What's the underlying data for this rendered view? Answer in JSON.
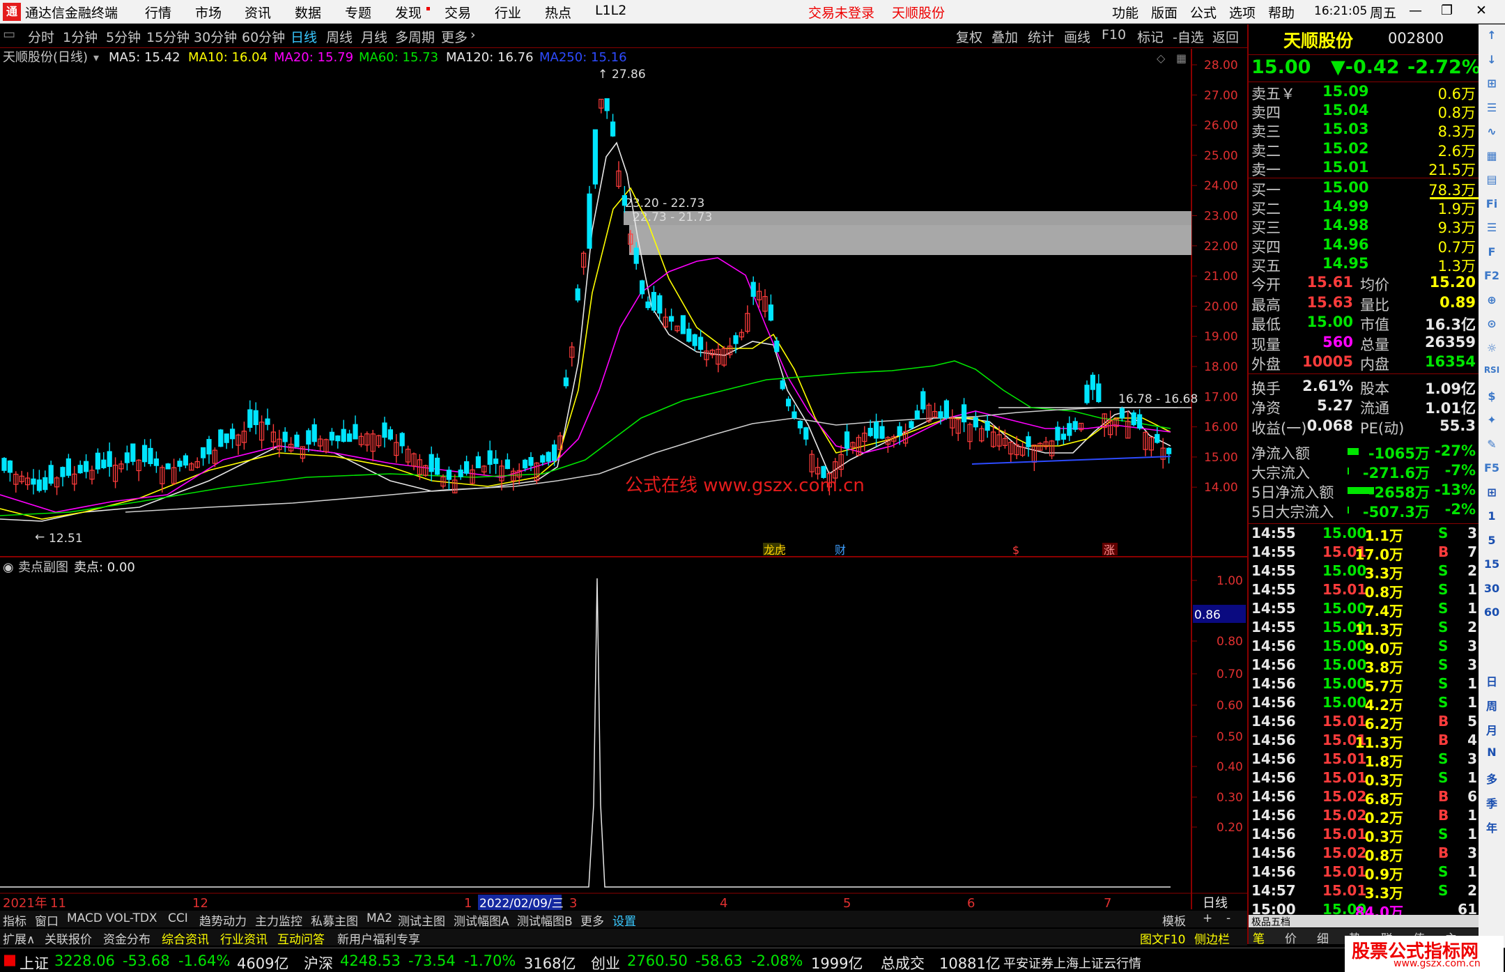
{
  "titlebar": {
    "app_name": "通达信金融终端",
    "menu": [
      "行情",
      "市场",
      "资讯",
      "数据",
      "专题",
      "发现",
      "交易",
      "行业",
      "热点",
      "L1L2"
    ],
    "login_status": "交易未登录",
    "stock_name": "天顺股份",
    "right_menu": [
      "功能",
      "版面",
      "公式",
      "选项",
      "帮助"
    ],
    "time": "16:21:05",
    "weekday": "周五"
  },
  "toolbar": {
    "periods": [
      "分时",
      "1分钟",
      "5分钟",
      "15分钟",
      "30分钟",
      "60分钟",
      "日线",
      "周线",
      "月线",
      "多周期",
      "更多"
    ],
    "selected": "日线",
    "right_buttons": [
      "复权",
      "叠加",
      "统计",
      "画线",
      "F10",
      "标记",
      "-自选",
      "返回"
    ]
  },
  "main_chart": {
    "stock_label": "天顺股份(日线)",
    "ma": [
      {
        "label": "MA5: 15.42",
        "color": "#e8e8e8"
      },
      {
        "label": "MA10: 16.04",
        "color": "#ffff00"
      },
      {
        "label": "MA20: 15.79",
        "color": "#ff00ff"
      },
      {
        "label": "MA60: 15.73",
        "color": "#00e600"
      },
      {
        "label": "MA120: 16.76",
        "color": "#e8e8e8"
      },
      {
        "label": "MA250: 15.16",
        "color": "#2d4bff"
      }
    ],
    "y_ticks": [
      "28.00",
      "27.00",
      "26.00",
      "25.00",
      "24.00",
      "23.00",
      "22.00",
      "21.00",
      "20.00",
      "19.00",
      "18.00",
      "17.00",
      "16.00",
      "15.00",
      "14.00"
    ],
    "high_label": "27.86",
    "low_label": "12.51",
    "box_label_1": "23.20 - 22.73",
    "box_label_2": "22.73 - 21.73",
    "line_label": "16.78 - 16.68",
    "watermark": "公式在线  www.gszx.com.cn",
    "event_marks": [
      "龙虎",
      "财",
      "$",
      "涨"
    ]
  },
  "sub_chart": {
    "title": "卖点副图",
    "value_label": "卖点: 0.00",
    "y_ticks": [
      "1.00",
      "0.80",
      "0.70",
      "0.60",
      "0.50",
      "0.40",
      "0.30",
      "0.20"
    ],
    "cursor_value": "0.86"
  },
  "x_axis": {
    "labels": [
      "2021年",
      "11",
      "12",
      "1",
      "2",
      "3",
      "4",
      "5",
      "6",
      "7"
    ],
    "cursor_date": "2022/02/09/三",
    "period_label": "日线"
  },
  "tabs1": [
    "指标",
    "窗口",
    "MACD",
    "VOL-TDX",
    "CCI",
    "趋势动力",
    "主力监控",
    "私募主图",
    "MA2",
    "测试主图",
    "测试幅图A",
    "测试幅图B",
    "更多",
    "设置"
  ],
  "tabs1_right": [
    "模板",
    "+",
    "-"
  ],
  "tabs2": [
    "扩展∧",
    "关联报价",
    "资金分布",
    "综合资讯",
    "行业资讯",
    "互动问答",
    "新用户福利专享"
  ],
  "tabs2_right": [
    "图文F10",
    "侧边栏"
  ],
  "quote": {
    "name": "天顺股份",
    "code": "002800",
    "price": "15.00",
    "change": "▼-0.42",
    "change_pct": "-2.72%",
    "sell": [
      {
        "label": "卖五￥",
        "price": "15.09",
        "vol": "0.6万"
      },
      {
        "label": "卖四",
        "price": "15.04",
        "vol": "0.8万"
      },
      {
        "label": "卖三",
        "price": "15.03",
        "vol": "8.3万"
      },
      {
        "label": "卖二",
        "price": "15.02",
        "vol": "2.6万"
      },
      {
        "label": "卖一",
        "price": "15.01",
        "vol": "21.5万"
      }
    ],
    "buy": [
      {
        "label": "买一",
        "price": "15.00",
        "vol": "78.3万"
      },
      {
        "label": "买二",
        "price": "14.99",
        "vol": "1.9万"
      },
      {
        "label": "买三",
        "price": "14.98",
        "vol": "9.3万"
      },
      {
        "label": "买四",
        "price": "14.96",
        "vol": "0.7万"
      },
      {
        "label": "买五",
        "price": "14.95",
        "vol": "1.3万"
      }
    ],
    "stats1": [
      {
        "l1": "今开",
        "v1": "15.61",
        "l2": "均价",
        "v2": "15.20"
      },
      {
        "l1": "最高",
        "v1": "15.63",
        "l2": "量比",
        "v2": "0.89"
      },
      {
        "l1": "最低",
        "v1": "15.00",
        "l2": "市值",
        "v2": "16.3亿"
      },
      {
        "l1": "现量",
        "v1": "560",
        "l2": "总量",
        "v2": "26359"
      },
      {
        "l1": "外盘",
        "v1": "10005",
        "l2": "内盘",
        "v2": "16354"
      }
    ],
    "stats2": [
      {
        "l1": "换手",
        "v1": "2.61%",
        "l2": "股本",
        "v2": "1.09亿"
      },
      {
        "l1": "净资",
        "v1": "5.27",
        "l2": "流通",
        "v2": "1.01亿"
      },
      {
        "l1": "收益(一)",
        "v1": "0.068",
        "l2": "PE(动)",
        "v2": "55.3"
      }
    ],
    "flows": [
      {
        "label": "净流入额",
        "value": "-1065万",
        "pct": "-27%"
      },
      {
        "label": "大宗流入",
        "value": "-271.6万",
        "pct": "-7%"
      },
      {
        "label": "5日净流入额",
        "value": "-2658万",
        "pct": "-13%"
      },
      {
        "label": "5日大宗流入",
        "value": "-507.3万",
        "pct": "-2%"
      }
    ],
    "ticks": [
      [
        "14:55",
        "15.00",
        "1.1万",
        "S",
        "3"
      ],
      [
        "14:55",
        "15.01",
        "17.0万",
        "B",
        "7"
      ],
      [
        "14:55",
        "15.00",
        "3.3万",
        "S",
        "2"
      ],
      [
        "14:55",
        "15.01",
        "0.8万",
        "S",
        "1"
      ],
      [
        "14:55",
        "15.00",
        "7.4万",
        "S",
        "1"
      ],
      [
        "14:55",
        "15.00",
        "11.3万",
        "S",
        "2"
      ],
      [
        "14:56",
        "15.00",
        "9.0万",
        "S",
        "3"
      ],
      [
        "14:56",
        "15.00",
        "3.8万",
        "S",
        "3"
      ],
      [
        "14:56",
        "15.00",
        "5.7万",
        "S",
        "1"
      ],
      [
        "14:56",
        "15.00",
        "4.2万",
        "S",
        "1"
      ],
      [
        "14:56",
        "15.01",
        "6.2万",
        "B",
        "5"
      ],
      [
        "14:56",
        "15.01",
        "11.3万",
        "B",
        "4"
      ],
      [
        "14:56",
        "15.01",
        "1.8万",
        "S",
        "3"
      ],
      [
        "14:56",
        "15.01",
        "0.3万",
        "S",
        "1"
      ],
      [
        "14:56",
        "15.02",
        "6.8万",
        "B",
        "6"
      ],
      [
        "14:56",
        "15.02",
        "0.2万",
        "B",
        "1"
      ],
      [
        "14:56",
        "15.01",
        "0.3万",
        "S",
        "1"
      ],
      [
        "14:56",
        "15.02",
        "0.8万",
        "B",
        "3"
      ],
      [
        "14:56",
        "15.01",
        "0.9万",
        "S",
        "1"
      ],
      [
        "14:57",
        "15.01",
        "3.3万",
        "S",
        "2"
      ],
      [
        "15:00",
        "15.00",
        "84.0万",
        "",
        "61"
      ]
    ],
    "mini_toolbar": "极品五档",
    "bottom_tabs": [
      "笔",
      "价",
      "细",
      "势",
      "联",
      "值",
      "主"
    ]
  },
  "side_icons": [
    "↑",
    "↓",
    "⊞",
    "☰",
    "∿",
    "▦",
    "▤",
    "Fi",
    "☰",
    "F",
    "F2",
    "⊕",
    "⊙",
    "☼",
    "RSI",
    "$",
    "✦",
    "✎",
    "F5",
    "⊞",
    "1",
    "5",
    "15",
    "30",
    "60",
    "日",
    "周",
    "月",
    "N",
    "多",
    "季",
    "年"
  ],
  "status": {
    "sh_label": "上证",
    "sh_val": "3228.06",
    "sh_chg": "-53.68",
    "sh_pct": "-1.64%",
    "sh_amt": "4609亿",
    "hs_label": "沪深",
    "hs_val": "4248.53",
    "hs_chg": "-73.54",
    "hs_pct": "-1.70%",
    "hs_amt": "3168亿",
    "cy_label": "创业",
    "cy_val": "2760.50",
    "cy_chg": "-58.63",
    "cy_pct": "-2.08%",
    "cy_amt": "1999亿",
    "total_label": "总成交",
    "total_val": "10881亿",
    "provider": "平安证券上海上证云行情",
    "brand_title": "股票公式指标网",
    "brand_url": "www.gszx.com.cn"
  }
}
